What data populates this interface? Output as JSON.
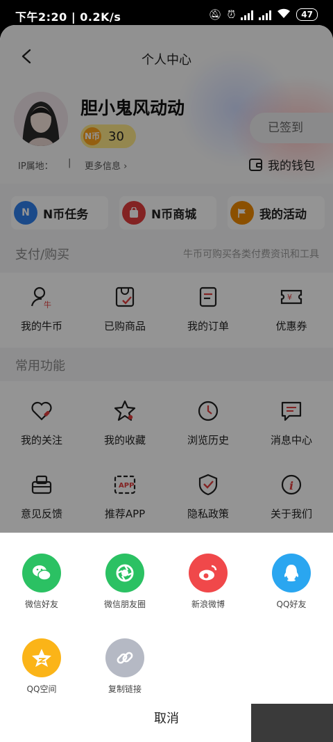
{
  "status_bar": {
    "time": "下午2:20",
    "speed": "0.2K/s",
    "battery": "47"
  },
  "header": {
    "title": "个人中心"
  },
  "profile": {
    "username": "胆小鬼风动动",
    "coin_badge": "N币",
    "coin_count": "30",
    "ip_label": "IP属地：",
    "ip_separator": "|",
    "more_info": "更多信息 ›",
    "sign_in": "已签到",
    "wallet": "我的钱包"
  },
  "quick_actions": [
    {
      "label": "N币任务",
      "icon_text": "N",
      "color": "#2f80ed"
    },
    {
      "label": "N币商城",
      "icon_text": "",
      "color": "#e23d3d"
    },
    {
      "label": "我的活动",
      "icon_text": "",
      "color": "#f08a00"
    }
  ],
  "payment_section": {
    "title": "支付/购买",
    "subtitle": "牛币可购买各类付费资讯和工具",
    "items": [
      {
        "label": "我的牛币",
        "icon": "user-coin-icon"
      },
      {
        "label": "已购商品",
        "icon": "purchased-icon"
      },
      {
        "label": "我的订单",
        "icon": "order-icon"
      },
      {
        "label": "优惠券",
        "icon": "coupon-icon"
      }
    ]
  },
  "common_section": {
    "title": "常用功能",
    "items": [
      {
        "label": "我的关注",
        "icon": "heart-icon"
      },
      {
        "label": "我的收藏",
        "icon": "star-icon"
      },
      {
        "label": "浏览历史",
        "icon": "clock-icon"
      },
      {
        "label": "消息中心",
        "icon": "message-icon"
      },
      {
        "label": "意见反馈",
        "icon": "feedback-icon"
      },
      {
        "label": "推荐APP",
        "icon": "app-icon"
      },
      {
        "label": "隐私政策",
        "icon": "shield-icon"
      },
      {
        "label": "关于我们",
        "icon": "info-icon"
      }
    ],
    "app_icon_text": "APP",
    "info_icon_text": "i"
  },
  "share_sheet": {
    "options": [
      {
        "label": "微信好友",
        "color": "#2bc163"
      },
      {
        "label": "微信朋友圈",
        "color": "#2bc163"
      },
      {
        "label": "新浪微博",
        "color": "#f0484a"
      },
      {
        "label": "QQ好友",
        "color": "#2aa6f0"
      },
      {
        "label": "QQ空间",
        "color": "#fbb418"
      },
      {
        "label": "复制链接",
        "color": "#b5b9c4"
      }
    ],
    "cancel": "取消"
  },
  "colors": {
    "accent_red": "#e23d3d",
    "overlay": "rgba(0,0,0,0.42)"
  }
}
